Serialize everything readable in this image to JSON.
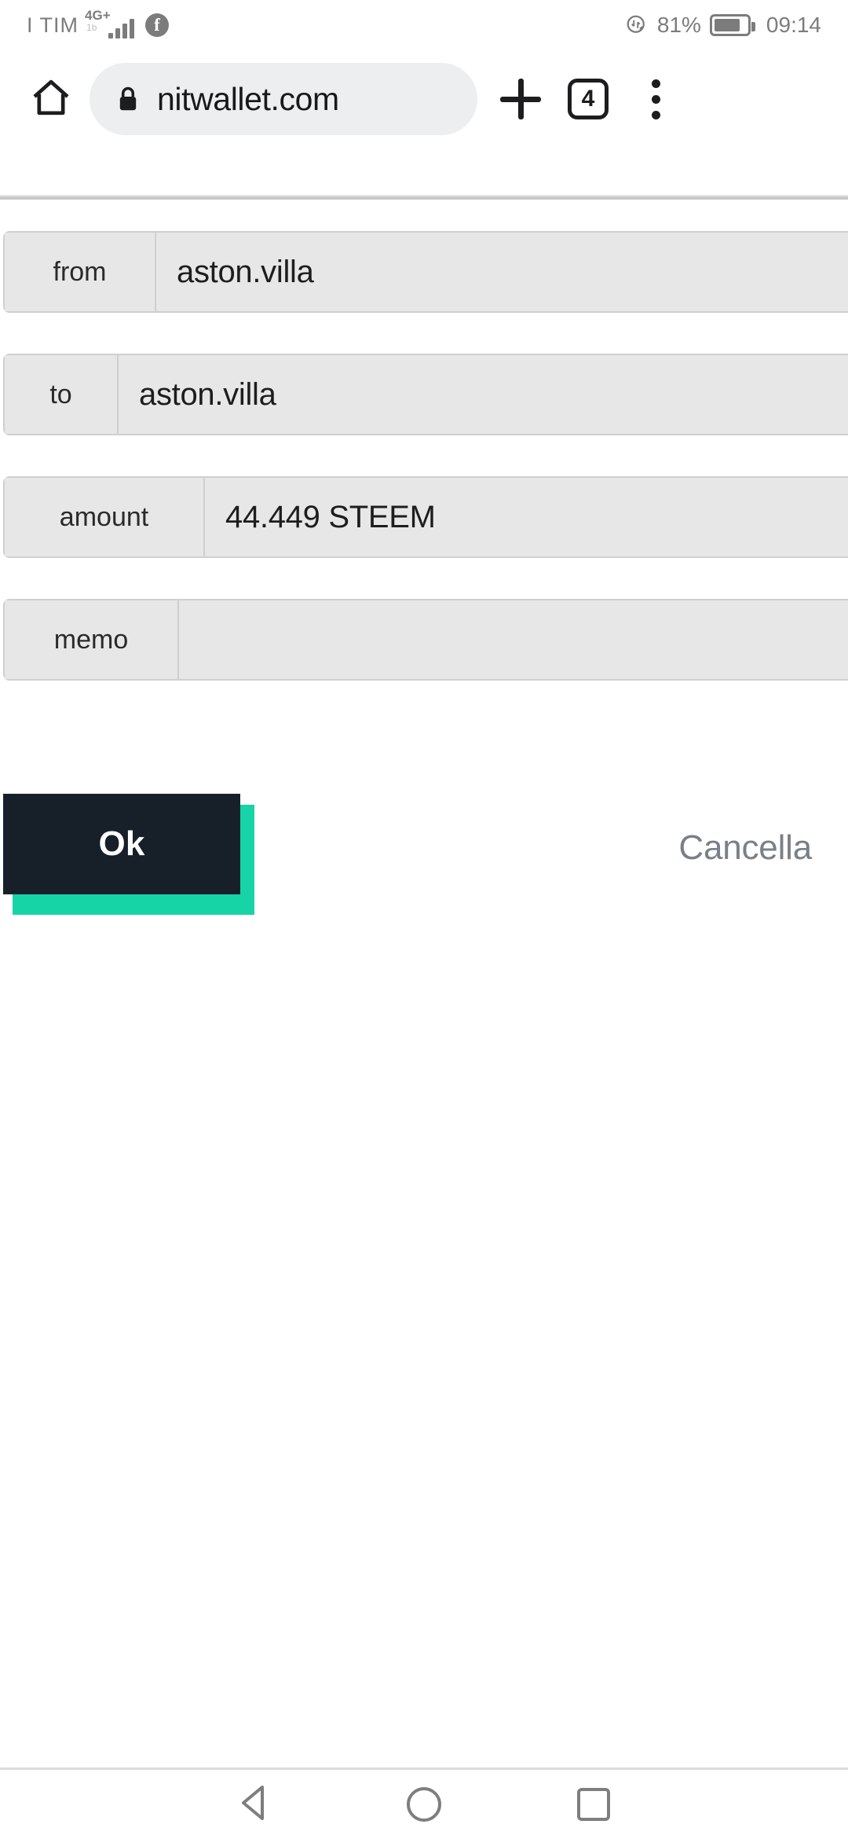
{
  "status_bar": {
    "carrier": "I TIM",
    "network": "4G+",
    "network_sub": "1b",
    "social_icon": "facebook-icon",
    "eco_icon": "eco-charge-icon",
    "battery_percent": "81%",
    "battery_level": 81,
    "clock": "09:14"
  },
  "browser": {
    "home_icon": "home-icon",
    "lock_icon": "lock-icon",
    "url": "nitwallet.com",
    "new_tab_icon": "plus-icon",
    "tab_count": "4",
    "menu_icon": "more-vertical-icon"
  },
  "form": {
    "fields": [
      {
        "label": "from",
        "value": "aston.villa",
        "placeholder": "from",
        "label_width": 193
      },
      {
        "label": "to",
        "value": "aston.villa",
        "placeholder": "to",
        "label_width": 145
      },
      {
        "label": "amount",
        "value": "44.449 STEEM",
        "placeholder": "amount",
        "label_width": 255
      },
      {
        "label": "memo",
        "value": "",
        "placeholder": "memo",
        "label_width": 222
      }
    ]
  },
  "actions": {
    "ok_label": "Ok",
    "cancel_label": "Cancella",
    "ok_bg": "#172029",
    "ok_shadow": "#17d4a7",
    "cancel_color": "#7a8088"
  },
  "nav_bar": {
    "back_icon": "back-triangle-icon",
    "home_icon": "home-circle-icon",
    "recents_icon": "recents-square-icon"
  }
}
